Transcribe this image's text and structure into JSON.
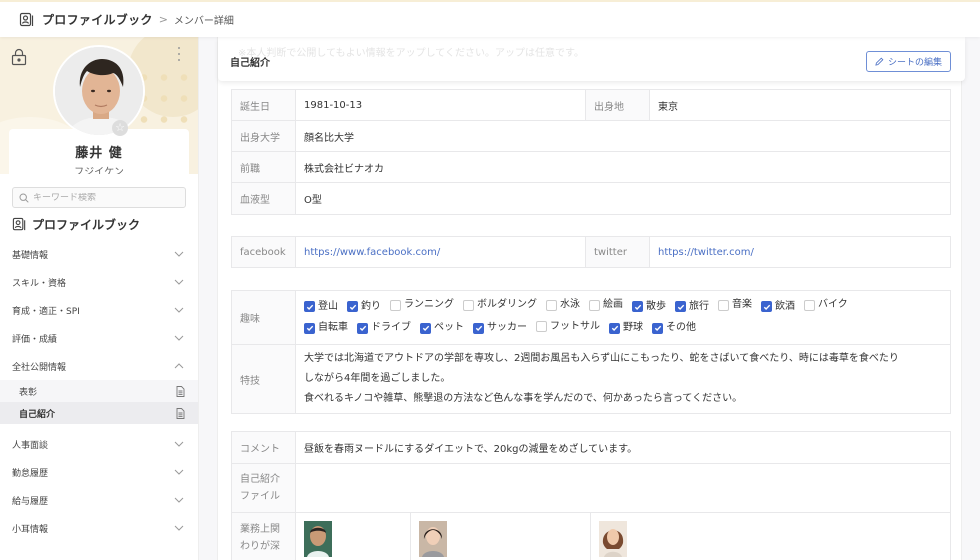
{
  "breadcrumb": {
    "root": "プロファイルブック",
    "separator": ">",
    "current": "メンバー詳細"
  },
  "profile": {
    "name": "藤井 健",
    "kana": "フジイケン"
  },
  "sidebar": {
    "search_placeholder": "キーワード検索",
    "section_title": "プロファイルブック",
    "items": [
      {
        "label": "基礎情報",
        "expanded": false
      },
      {
        "label": "スキル・資格",
        "expanded": false
      },
      {
        "label": "育成・適正・SPI",
        "expanded": false
      },
      {
        "label": "評価・成績",
        "expanded": false
      },
      {
        "label": "全社公開情報",
        "expanded": true
      },
      {
        "label": "人事面談",
        "expanded": false
      },
      {
        "label": "勤怠履歴",
        "expanded": false
      },
      {
        "label": "給与履歴",
        "expanded": false
      },
      {
        "label": "小耳情報",
        "expanded": false
      }
    ],
    "sub_items": [
      {
        "label": "表彰",
        "active": false
      },
      {
        "label": "自己紹介",
        "active": true
      }
    ]
  },
  "sheet": {
    "note": "※本人判断で公開してもよい情報をアップしてください。アップは任意です。",
    "title": "自己紹介",
    "edit_label": "シートの編集"
  },
  "basic": {
    "birthday_label": "誕生日",
    "birthday": "1981-10-13",
    "birthplace_label": "出身地",
    "birthplace": "東京",
    "university_label": "出身大学",
    "university": "顔名比大学",
    "previous_job_label": "前職",
    "previous_job": "株式会社ビナオカ",
    "blood_type_label": "血液型",
    "blood_type": "O型"
  },
  "social": {
    "facebook_label": "facebook",
    "facebook_url": "https://www.facebook.com/",
    "twitter_label": "twitter",
    "twitter_url": "https://twitter.com/"
  },
  "hobbies": {
    "label": "趣味",
    "options": [
      {
        "label": "登山",
        "checked": true
      },
      {
        "label": "釣り",
        "checked": true
      },
      {
        "label": "ランニング",
        "checked": false
      },
      {
        "label": "ボルダリング",
        "checked": false
      },
      {
        "label": "水泳",
        "checked": false
      },
      {
        "label": "絵画",
        "checked": false
      },
      {
        "label": "散歩",
        "checked": true
      },
      {
        "label": "旅行",
        "checked": true
      },
      {
        "label": "音楽",
        "checked": false
      },
      {
        "label": "飲酒",
        "checked": true
      },
      {
        "label": "バイク",
        "checked": false
      },
      {
        "label": "自転車",
        "checked": true
      },
      {
        "label": "ドライブ",
        "checked": true
      },
      {
        "label": "ペット",
        "checked": true
      },
      {
        "label": "サッカー",
        "checked": true
      },
      {
        "label": "フットサル",
        "checked": false
      },
      {
        "label": "野球",
        "checked": true
      },
      {
        "label": "その他",
        "checked": true
      }
    ]
  },
  "skills": {
    "label": "特技",
    "lines": [
      "大学では北海道でアウトドアの学部を専攻し、2週間お風呂も入らず山にこもったり、蛇をさばいて食べたり、時には毒草を食べたり",
      "しながら4年間を過ごしました。",
      "食べれるキノコや雑草、熊撃退の方法など色んな事を学んだので、何かあったら言ってください。"
    ]
  },
  "extra": {
    "comment_label": "コメント",
    "comment": "昼飯を春雨ヌードルにするダイエットで、20kgの減量をめざしています。",
    "file_label": "自己紹介ファイル",
    "file_label_lines": [
      "自己紹介",
      "ファイル"
    ],
    "related_label_lines": [
      "業務上関",
      "わりが深"
    ]
  },
  "colors": {
    "accent": "#3a63cf",
    "link": "#4a6fc4",
    "hero_bg": "#f8f1e0"
  }
}
